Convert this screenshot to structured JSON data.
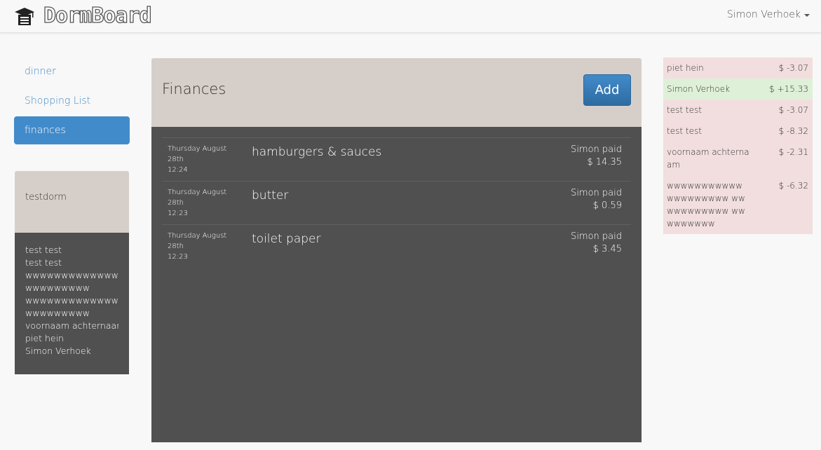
{
  "navbar": {
    "brand": "DormBoard",
    "brand_icon": "graduation-cap-icon",
    "user": "Simon Verhoek"
  },
  "sidebar": {
    "items": [
      {
        "label": "dinner",
        "active": false
      },
      {
        "label": "Shopping List",
        "active": false
      },
      {
        "label": "finances",
        "active": true
      }
    ]
  },
  "dorm": {
    "name": "testdorm",
    "members": [
      "test test",
      "test test",
      "wwwwwwwwwwwww",
      "wwwwwwwww",
      "wwwwwwwwwwwww",
      "wwwwwwwww",
      "voornaam achternaam",
      "piet hein",
      "Simon Verhoek"
    ]
  },
  "finances": {
    "title": "Finances",
    "add_label": "Add",
    "transactions": [
      {
        "date": "Thursday August",
        "day": "28th",
        "time": "12:24",
        "name": "hamburgers & sauces",
        "payer": "Simon paid",
        "amount": "$ 14.35"
      },
      {
        "date": "Thursday August",
        "day": "28th",
        "time": "12:23",
        "name": "butter",
        "payer": "Simon paid",
        "amount": "$ 0.59"
      },
      {
        "date": "Thursday August",
        "day": "28th",
        "time": "12:23",
        "name": "toilet paper",
        "payer": "Simon paid",
        "amount": "$ 3.45"
      }
    ]
  },
  "balances": [
    {
      "name": "piet hein",
      "amount": "$ -3.07",
      "positive": false
    },
    {
      "name": "Simon Verhoek",
      "amount": "$ +15.33",
      "positive": true
    },
    {
      "name": "test test",
      "amount": "$ -3.07",
      "positive": false
    },
    {
      "name": "test test",
      "amount": "$ -8.32",
      "positive": false
    },
    {
      "name": "voornaam achternaam",
      "amount": "$ -2.31",
      "positive": false
    },
    {
      "name": "wwwwwwwwwww wwwwwwwww wwwwwwwwwww wwwwwwwww",
      "amount": "$ -6.32",
      "positive": false
    }
  ],
  "colors": {
    "accent": "#428bca",
    "panel_head": "#d6cfc9",
    "panel_body": "#505050",
    "negative_bg": "#f2dede",
    "positive_bg": "#dff0d8"
  }
}
